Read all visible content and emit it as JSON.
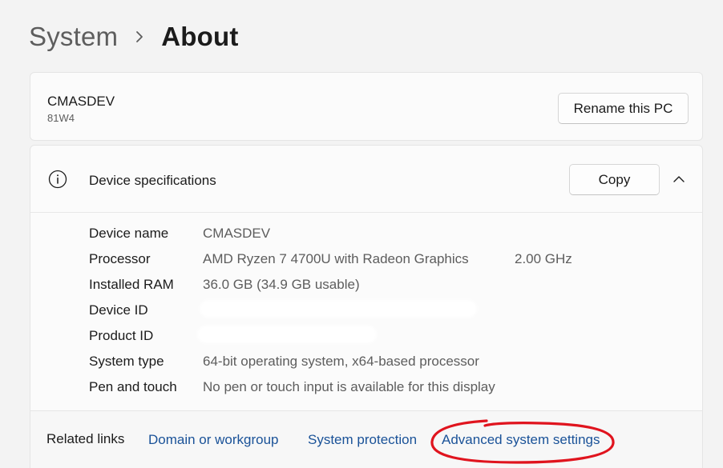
{
  "breadcrumb": {
    "parent": "System",
    "current": "About"
  },
  "pc": {
    "name": "CMASDEV",
    "model": "81W4",
    "rename_label": "Rename this PC"
  },
  "specs": {
    "title": "Device specifications",
    "copy_label": "Copy",
    "icons": {
      "info": "info-icon",
      "collapse": "chevron-up-icon"
    },
    "rows": [
      {
        "label": "Device name",
        "value": "CMASDEV"
      },
      {
        "label": "Processor",
        "value": "AMD Ryzen 7 4700U with Radeon Graphics",
        "extra": "2.00 GHz"
      },
      {
        "label": "Installed RAM",
        "value": "36.0 GB (34.9 GB usable)"
      },
      {
        "label": "Device ID",
        "value": ""
      },
      {
        "label": "Product ID",
        "value": ""
      },
      {
        "label": "System type",
        "value": "64-bit operating system, x64-based processor"
      },
      {
        "label": "Pen and touch",
        "value": "No pen or touch input is available for this display"
      }
    ]
  },
  "related": {
    "title": "Related links",
    "links": [
      {
        "label": "Domain or workgroup"
      },
      {
        "label": "System protection"
      },
      {
        "label": "Advanced system settings"
      }
    ]
  },
  "colors": {
    "background": "#f3f3f3",
    "card": "#fbfbfb",
    "link": "#1a5298",
    "annotation": "#e0141e"
  }
}
